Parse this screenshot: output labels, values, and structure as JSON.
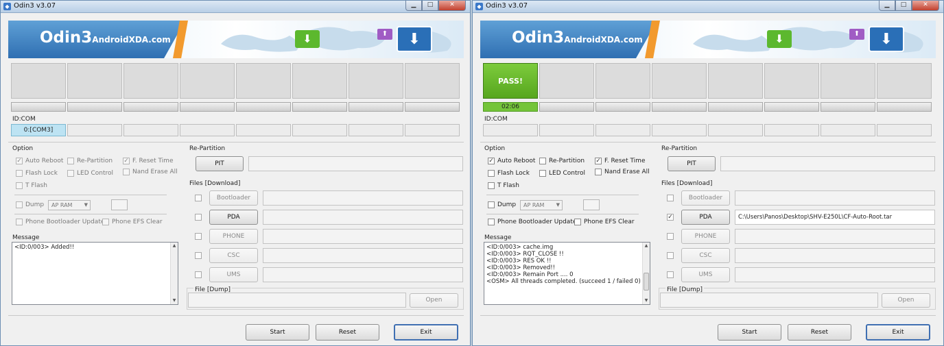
{
  "windows": [
    {
      "title": "Odin3 v3.07",
      "window_controls": [
        "minimize-icon",
        "maximize-icon",
        "close-icon"
      ],
      "banner": {
        "logo_main": "Odin3",
        "logo_sub": "AndroidXDA.com"
      },
      "slots": [
        "",
        "",
        "",
        "",
        "",
        "",
        "",
        ""
      ],
      "progress_bars": [
        "",
        "",
        "",
        "",
        "",
        "",
        "",
        ""
      ],
      "id_com_label": "ID:COM",
      "coms": [
        "0:[COM3]",
        "",
        "",
        "",
        "",
        "",
        "",
        ""
      ],
      "option": {
        "label": "Option",
        "auto_reboot": {
          "label": "Auto Reboot",
          "checked": true
        },
        "re_partition": {
          "label": "Re-Partition",
          "checked": false
        },
        "f_reset_time": {
          "label": "F. Reset Time",
          "checked": true
        },
        "flash_lock": {
          "label": "Flash Lock",
          "checked": false
        },
        "led_control": {
          "label": "LED Control",
          "checked": false
        },
        "nand_erase_all": {
          "label": "Nand Erase All",
          "checked": false
        },
        "t_flash": {
          "label": "T Flash",
          "checked": false
        },
        "dump": {
          "label": "Dump",
          "checked": false
        },
        "dump_select": "AP RAM",
        "phone_bootloader_update": {
          "label": "Phone Bootloader Update",
          "checked": false
        },
        "phone_efs_clear": {
          "label": "Phone EFS Clear",
          "checked": false
        }
      },
      "message": {
        "label": "Message",
        "lines": [
          "<ID:0/003> Added!!"
        ]
      },
      "re_partition": {
        "label": "Re-Partition",
        "pit_button": "PIT",
        "pit_value": ""
      },
      "files": {
        "label": "Files [Download]",
        "rows": [
          {
            "button": "Bootloader",
            "checked": false,
            "value": ""
          },
          {
            "button": "PDA",
            "checked": false,
            "value": ""
          },
          {
            "button": "PHONE",
            "checked": false,
            "value": ""
          },
          {
            "button": "CSC",
            "checked": false,
            "value": ""
          },
          {
            "button": "UMS",
            "checked": false,
            "value": ""
          }
        ]
      },
      "file_dump": {
        "label": "File [Dump]",
        "value": "",
        "open_button": "Open"
      },
      "buttons": {
        "start": "Start",
        "reset": "Reset",
        "exit": "Exit"
      }
    },
    {
      "title": "Odin3 v3.07",
      "window_controls": [
        "minimize-icon",
        "maximize-icon",
        "close-icon"
      ],
      "banner": {
        "logo_main": "Odin3",
        "logo_sub": "AndroidXDA.com"
      },
      "slots": [
        "PASS!",
        "",
        "",
        "",
        "",
        "",
        "",
        ""
      ],
      "progress_bars": [
        "02:06",
        "",
        "",
        "",
        "",
        "",
        "",
        ""
      ],
      "id_com_label": "ID:COM",
      "coms": [
        "",
        "",
        "",
        "",
        "",
        "",
        "",
        ""
      ],
      "option": {
        "label": "Option",
        "auto_reboot": {
          "label": "Auto Reboot",
          "checked": true
        },
        "re_partition": {
          "label": "Re-Partition",
          "checked": false
        },
        "f_reset_time": {
          "label": "F. Reset Time",
          "checked": true
        },
        "flash_lock": {
          "label": "Flash Lock",
          "checked": false
        },
        "led_control": {
          "label": "LED Control",
          "checked": false
        },
        "nand_erase_all": {
          "label": "Nand Erase All",
          "checked": false
        },
        "t_flash": {
          "label": "T Flash",
          "checked": false
        },
        "dump": {
          "label": "Dump",
          "checked": false
        },
        "dump_select": "AP RAM",
        "phone_bootloader_update": {
          "label": "Phone Bootloader Update",
          "checked": false
        },
        "phone_efs_clear": {
          "label": "Phone EFS Clear",
          "checked": false
        }
      },
      "message": {
        "label": "Message",
        "lines": [
          "<ID:0/003> cache.img",
          "<ID:0/003> RQT_CLOSE !!",
          "<ID:0/003> RES OK !!",
          "<ID:0/003> Removed!!",
          "<ID:0/003> Remain Port .... 0",
          "<OSM> All threads completed. (succeed 1 / failed 0)"
        ]
      },
      "re_partition": {
        "label": "Re-Partition",
        "pit_button": "PIT",
        "pit_value": ""
      },
      "files": {
        "label": "Files [Download]",
        "rows": [
          {
            "button": "Bootloader",
            "checked": false,
            "value": ""
          },
          {
            "button": "PDA",
            "checked": true,
            "value": "C:\\Users\\Panos\\Desktop\\SHV-E250L\\CF-Auto-Root.tar"
          },
          {
            "button": "PHONE",
            "checked": false,
            "value": ""
          },
          {
            "button": "CSC",
            "checked": false,
            "value": ""
          },
          {
            "button": "UMS",
            "checked": false,
            "value": ""
          }
        ]
      },
      "file_dump": {
        "label": "File [Dump]",
        "value": "",
        "open_button": "Open"
      },
      "buttons": {
        "start": "Start",
        "reset": "Reset",
        "exit": "Exit"
      }
    }
  ]
}
